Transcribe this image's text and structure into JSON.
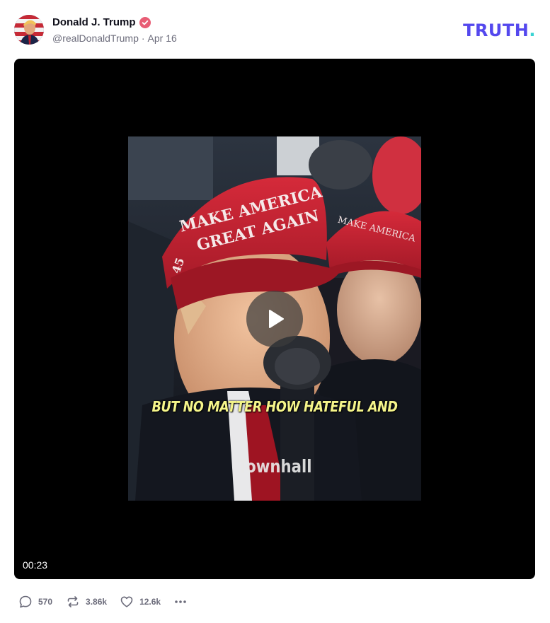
{
  "post": {
    "author_name": "Donald J. Trump",
    "handle": "@realDonaldTrump",
    "separator": "·",
    "date": "Apr 16",
    "verified": true
  },
  "brand": {
    "logo_text": "TRUTH",
    "logo_dot": ".",
    "logo_color": "#5448ee",
    "dot_color": "#39d3d3"
  },
  "video": {
    "duration": "00:23",
    "caption": "BUT NO MATTER HOW HATEFUL AND",
    "watermark": "Townhall",
    "hat_text_line1": "MAKE AMERICA",
    "hat_text_line2": "GREAT AGAIN"
  },
  "actions": {
    "replies": "570",
    "reposts": "3.86k",
    "likes": "12.6k"
  },
  "colors": {
    "verified_badge": "#e85d75",
    "action_text": "#6b6b7a",
    "hat_red": "#c8202f"
  }
}
